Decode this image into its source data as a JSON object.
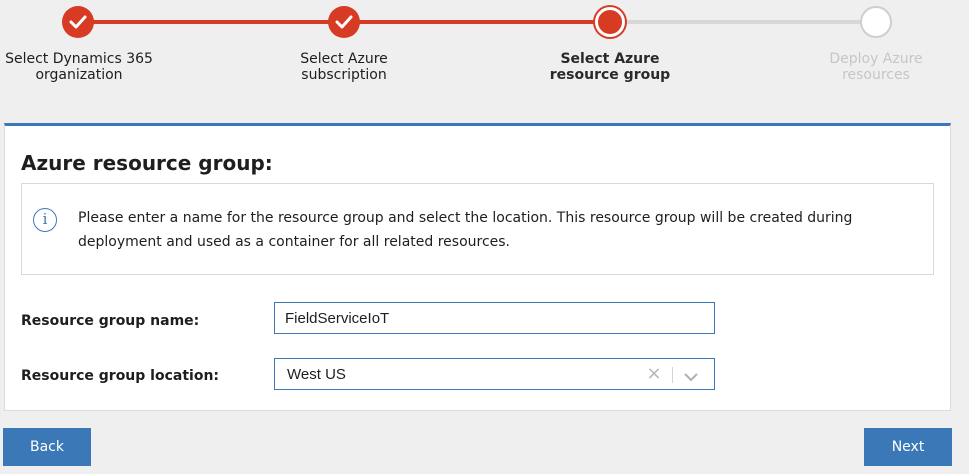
{
  "wizard": {
    "steps": [
      {
        "label": "Select Dynamics 365 organization",
        "state": "done"
      },
      {
        "label": "Select Azure subscription",
        "state": "done"
      },
      {
        "label": "Select Azure resource group",
        "state": "current"
      },
      {
        "label": "Deploy Azure resources",
        "state": "pending"
      }
    ],
    "colors": {
      "done": "#d83b23",
      "pending": "#d8d8d8",
      "accent": "#3b78b8"
    }
  },
  "panel": {
    "title": "Azure resource group:",
    "info_icon": "info-icon",
    "info_text": "Please enter a name for the resource group and select the location. This resource group will be created during deployment and used as a container for all related resources.",
    "name_label": "Resource group name:",
    "name_value": "FieldServiceIoT",
    "location_label": "Resource group location:",
    "location_value": "West US",
    "clear_glyph": "×"
  },
  "buttons": {
    "back": "Back",
    "next": "Next"
  }
}
